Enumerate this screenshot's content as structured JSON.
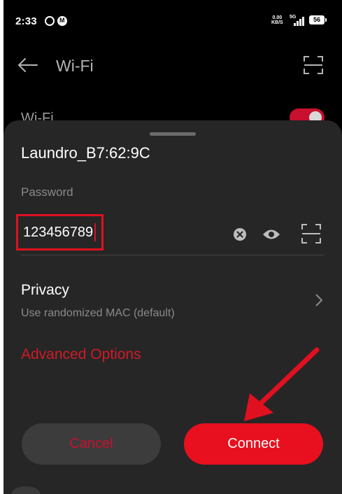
{
  "status_bar": {
    "time": "2:33",
    "speed_value": "0.00",
    "speed_unit": "KB/S",
    "network_type": "5G",
    "battery": "56",
    "icons": [
      "whatsapp-icon",
      "m-app-icon",
      "signal-icon",
      "battery-icon"
    ]
  },
  "header": {
    "title": "Wi-Fi",
    "back_icon": "arrow-left-icon",
    "scan_icon": "qr-scan-icon"
  },
  "wifi_row": {
    "label": "Wi-Fi",
    "toggle_on": true
  },
  "sheet": {
    "network_name": "Laundro_B7:62:9C",
    "password_label": "Password",
    "password_value": "123456789",
    "field_icons": [
      "clear-icon",
      "eye-icon",
      "qr-scan-icon"
    ],
    "privacy": {
      "title": "Privacy",
      "subtitle": "Use randomized MAC (default)"
    },
    "advanced_options": "Advanced Options",
    "cancel_label": "Cancel",
    "connect_label": "Connect"
  },
  "colors": {
    "accent": "#e8101e",
    "sheet_bg": "#262626",
    "annotation": "#e01020"
  }
}
